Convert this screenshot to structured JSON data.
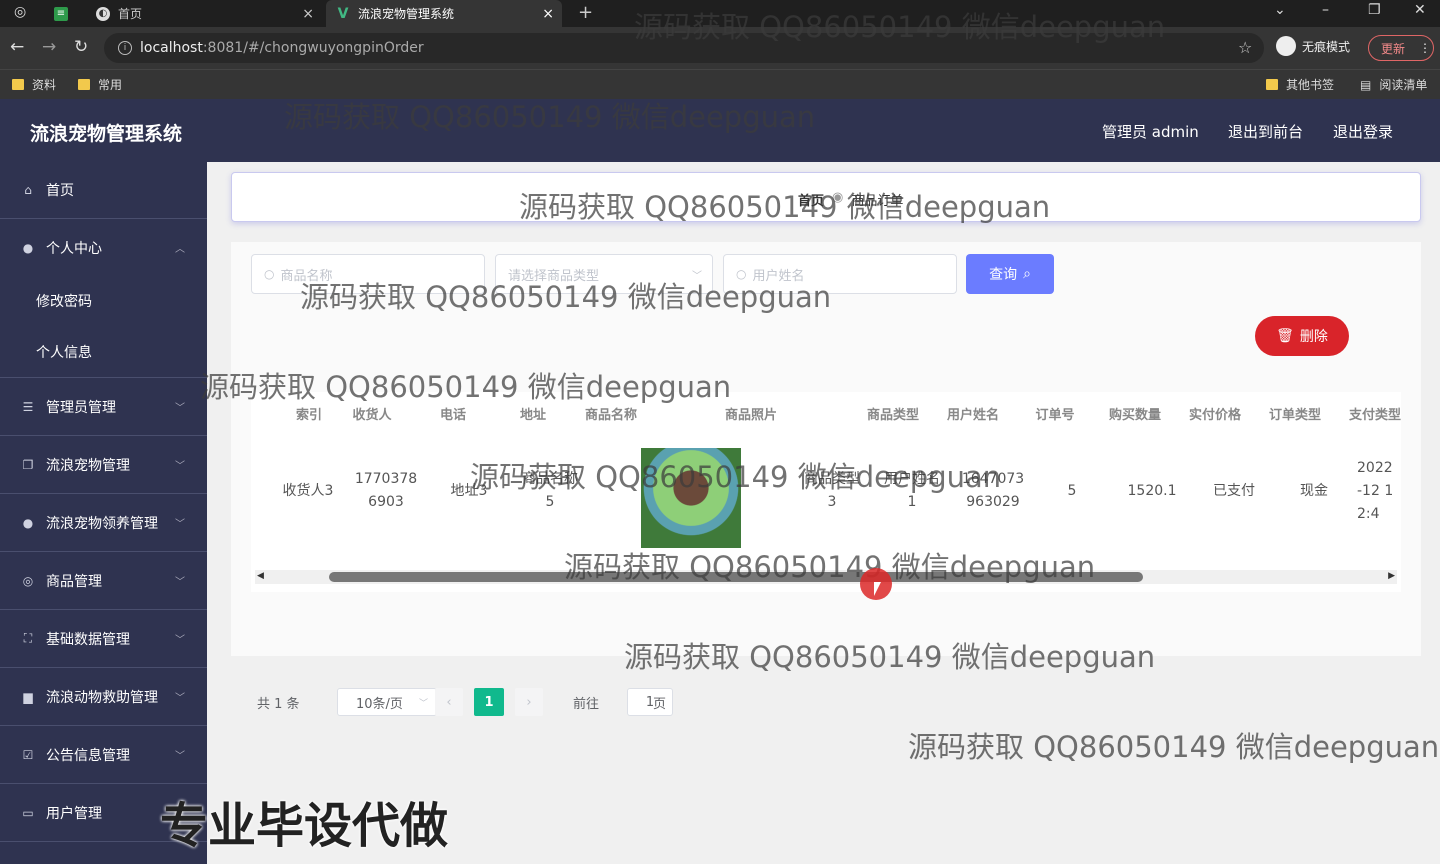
{
  "browser": {
    "tabs": [
      {
        "title": "首页",
        "active": false
      },
      {
        "title": "流浪宠物管理系统",
        "active": true
      }
    ],
    "url_host": "localhost",
    "url_path": ":8081/#/chongwuyongpinOrder",
    "incognito_label": "无痕模式",
    "update_label": "更新",
    "bookmarks": [
      "资料",
      "常用"
    ],
    "bookmarks_right": [
      "其他书签",
      "阅读清单"
    ]
  },
  "app": {
    "title": "流浪宠物管理系统",
    "header_links": [
      "管理员 admin",
      "退出到前台",
      "退出登录"
    ]
  },
  "sidebar": {
    "items": [
      {
        "label": "首页",
        "icon": "home-icon"
      },
      {
        "label": "个人中心",
        "icon": "user-icon",
        "expanded": true
      },
      {
        "label": "管理员管理",
        "icon": "list-icon"
      },
      {
        "label": "流浪宠物管理",
        "icon": "copy-icon"
      },
      {
        "label": "流浪宠物领养管理",
        "icon": "user-icon"
      },
      {
        "label": "商品管理",
        "icon": "compass-icon"
      },
      {
        "label": "基础数据管理",
        "icon": "fullscreen-icon"
      },
      {
        "label": "流浪动物救助管理",
        "icon": "briefcase-icon"
      },
      {
        "label": "公告信息管理",
        "icon": "checkbox-icon"
      },
      {
        "label": "用户管理",
        "icon": "message-icon"
      }
    ],
    "sub_items": [
      "修改密码",
      "个人信息"
    ]
  },
  "breadcrumb": [
    "首页",
    "商品订单"
  ],
  "search": {
    "product_name_placeholder": "商品名称",
    "product_type_placeholder": "请选择商品类型",
    "user_name_placeholder": "用户姓名",
    "query_label": "查询",
    "delete_label": "删除"
  },
  "table": {
    "headers": [
      "索引",
      "收货人",
      "电话",
      "地址",
      "商品名称",
      "商品照片",
      "商品类型",
      "用户姓名",
      "订单号",
      "购买数量",
      "实付价格",
      "订单类型",
      "支付类型"
    ],
    "row": {
      "receiver": "收货人3",
      "phone_1": "1770378",
      "phone_2": "6903",
      "address": "地址3",
      "product_name_1": "商品名称",
      "product_name_2": "5",
      "product_type_1": "商品类型",
      "product_type_2": "3",
      "user_name_1": "用户姓名",
      "user_name_2": "1",
      "order_no_1": "1647073",
      "order_no_2": "963029",
      "quantity": "5",
      "price": "1520.1",
      "order_type": "已支付",
      "pay_type": "现金",
      "time_1": "2022",
      "time_2": "-12 1",
      "time_3": "2:4"
    }
  },
  "pagination": {
    "total": "共 1 条",
    "page_size": "10条/页",
    "current": "1",
    "goto_label": "前往",
    "goto_value": "1",
    "page_suffix": "页"
  },
  "watermark_text": "源码获取 QQ86050149 微信deepguan",
  "promo_text": "专业毕设代做"
}
